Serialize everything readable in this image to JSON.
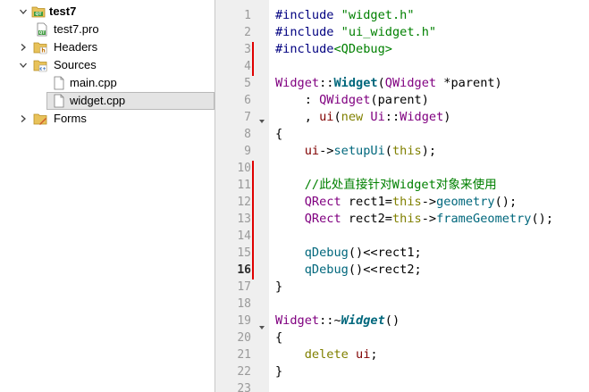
{
  "tree": {
    "items": [
      {
        "label": "test7",
        "icon": "project-folder-icon",
        "bold": true,
        "arrow": "down"
      },
      {
        "label": "test7.pro",
        "icon": "pro-file-icon",
        "bold": false,
        "arrow": ""
      },
      {
        "label": "Headers",
        "icon": "headers-folder-icon",
        "bold": false,
        "arrow": "right"
      },
      {
        "label": "Sources",
        "icon": "sources-folder-icon",
        "bold": false,
        "arrow": "down"
      },
      {
        "label": "main.cpp",
        "icon": "cpp-file-icon",
        "bold": false,
        "arrow": ""
      },
      {
        "label": "widget.cpp",
        "icon": "cpp-file-icon",
        "bold": false,
        "arrow": "",
        "selected": true
      },
      {
        "label": "Forms",
        "icon": "forms-folder-icon",
        "bold": false,
        "arrow": "right"
      }
    ]
  },
  "editor": {
    "line_numbers": [
      "1",
      "2",
      "3",
      "4",
      "5",
      "6",
      "7",
      "8",
      "9",
      "10",
      "11",
      "12",
      "13",
      "14",
      "15",
      "16",
      "17",
      "18",
      "19",
      "20",
      "21",
      "22",
      "23"
    ],
    "current_line": "16",
    "lines": [
      [
        [
          "c-pre",
          "#include "
        ],
        [
          "c-str",
          "\"widget.h\""
        ]
      ],
      [
        [
          "c-pre",
          "#include "
        ],
        [
          "c-str",
          "\"ui_widget.h\""
        ]
      ],
      [
        [
          "c-pre",
          "#include"
        ],
        [
          "c-str",
          "<QDebug>"
        ]
      ],
      [],
      [
        [
          "c-ty",
          "Widget"
        ],
        [
          "c-op",
          "::"
        ],
        [
          "c-fnb",
          "Widget"
        ],
        [
          "c-op",
          "("
        ],
        [
          "c-ty",
          "QWidget"
        ],
        [
          "c-pl",
          " "
        ],
        [
          "c-op",
          "*"
        ],
        [
          "c-pl",
          "parent)"
        ]
      ],
      [
        [
          "c-pl",
          "    : "
        ],
        [
          "c-ty",
          "QWidget"
        ],
        [
          "c-pl",
          "(parent)"
        ]
      ],
      [
        [
          "c-pl",
          "    , "
        ],
        [
          "c-fld",
          "ui"
        ],
        [
          "c-pl",
          "("
        ],
        [
          "c-kw",
          "new"
        ],
        [
          "c-pl",
          " "
        ],
        [
          "c-ty",
          "Ui"
        ],
        [
          "c-op",
          "::"
        ],
        [
          "c-ty",
          "Widget"
        ],
        [
          "c-pl",
          ")"
        ]
      ],
      [
        [
          "c-pl",
          "{"
        ]
      ],
      [
        [
          "c-pl",
          "    "
        ],
        [
          "c-fld",
          "ui"
        ],
        [
          "c-op",
          "->"
        ],
        [
          "c-fn",
          "setupUi"
        ],
        [
          "c-pl",
          "("
        ],
        [
          "c-kw",
          "this"
        ],
        [
          "c-pl",
          ");"
        ]
      ],
      [],
      [
        [
          "c-pl",
          "    "
        ],
        [
          "c-cm",
          "//此处直接针对Widget对象来使用"
        ]
      ],
      [
        [
          "c-pl",
          "    "
        ],
        [
          "c-ty",
          "QRect"
        ],
        [
          "c-pl",
          " rect1="
        ],
        [
          "c-kw",
          "this"
        ],
        [
          "c-op",
          "->"
        ],
        [
          "c-fn",
          "geometry"
        ],
        [
          "c-pl",
          "();"
        ]
      ],
      [
        [
          "c-pl",
          "    "
        ],
        [
          "c-ty",
          "QRect"
        ],
        [
          "c-pl",
          " rect2="
        ],
        [
          "c-kw",
          "this"
        ],
        [
          "c-op",
          "->"
        ],
        [
          "c-fn",
          "frameGeometry"
        ],
        [
          "c-pl",
          "();"
        ]
      ],
      [],
      [
        [
          "c-pl",
          "    "
        ],
        [
          "c-fn",
          "qDebug"
        ],
        [
          "c-pl",
          "()"
        ],
        [
          "c-op",
          "<<"
        ],
        [
          "c-pl",
          "rect1;"
        ]
      ],
      [
        [
          "c-pl",
          "    "
        ],
        [
          "c-fn",
          "qDebug"
        ],
        [
          "c-pl",
          "()"
        ],
        [
          "c-op",
          "<<"
        ],
        [
          "c-pl",
          "rect2;"
        ]
      ],
      [
        [
          "c-pl",
          "}"
        ]
      ],
      [],
      [
        [
          "c-ty",
          "Widget"
        ],
        [
          "c-op",
          "::~"
        ],
        [
          "c-fni",
          "Widget"
        ],
        [
          "c-pl",
          "()"
        ]
      ],
      [
        [
          "c-pl",
          "{"
        ]
      ],
      [
        [
          "c-pl",
          "    "
        ],
        [
          "c-kw",
          "delete"
        ],
        [
          "c-pl",
          " "
        ],
        [
          "c-fld",
          "ui"
        ],
        [
          "c-pl",
          ";"
        ]
      ],
      [
        [
          "c-pl",
          "}"
        ]
      ],
      []
    ]
  },
  "colors": {
    "modified_marker": "#e00000",
    "gutter_bg": "#efefef",
    "selection_bg": "#e4e4e4"
  }
}
